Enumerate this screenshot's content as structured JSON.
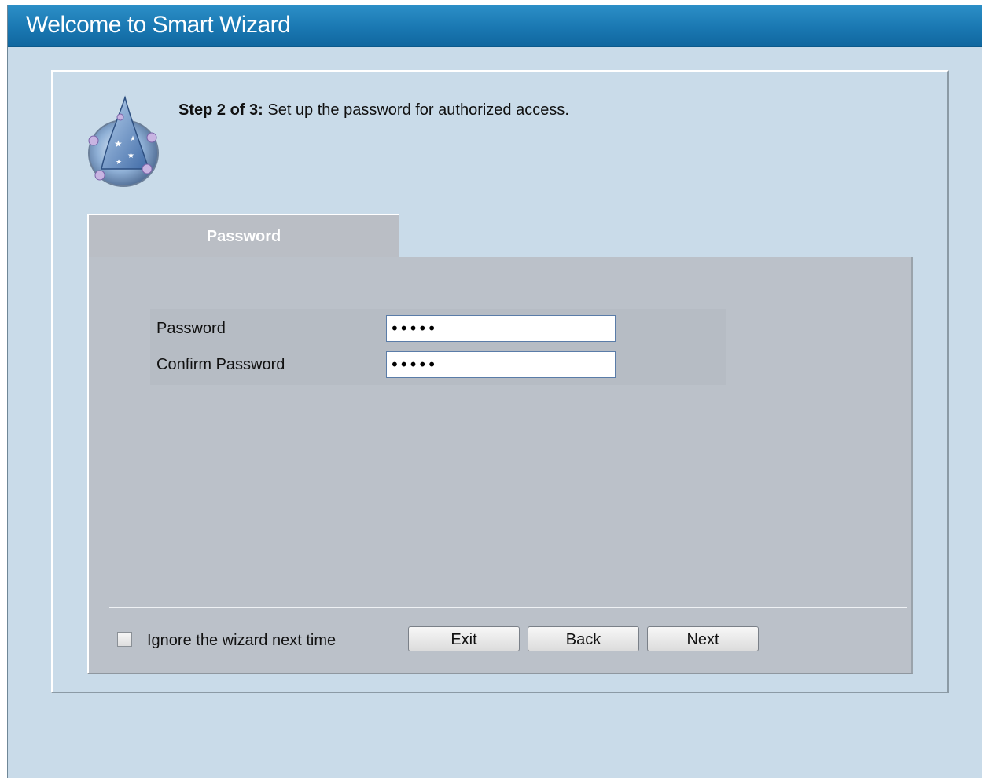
{
  "window": {
    "title": "Welcome to Smart Wizard"
  },
  "step": {
    "prefix": "Step 2 of 3:",
    "text": " Set up the password for authorized access."
  },
  "tab": {
    "label": "Password"
  },
  "form": {
    "password_label": "Password",
    "password_value": "•••••",
    "confirm_label": "Confirm Password",
    "confirm_value": "•••••"
  },
  "footer": {
    "ignore_label": "Ignore the wizard next time",
    "ignore_checked": false,
    "exit_label": "Exit",
    "back_label": "Back",
    "next_label": "Next"
  },
  "icons": {
    "wizard": "wizard-hat-icon"
  },
  "colors": {
    "titlebar": "#1a78b2",
    "background": "#c9dbe9",
    "panel": "#bbc1c9"
  }
}
